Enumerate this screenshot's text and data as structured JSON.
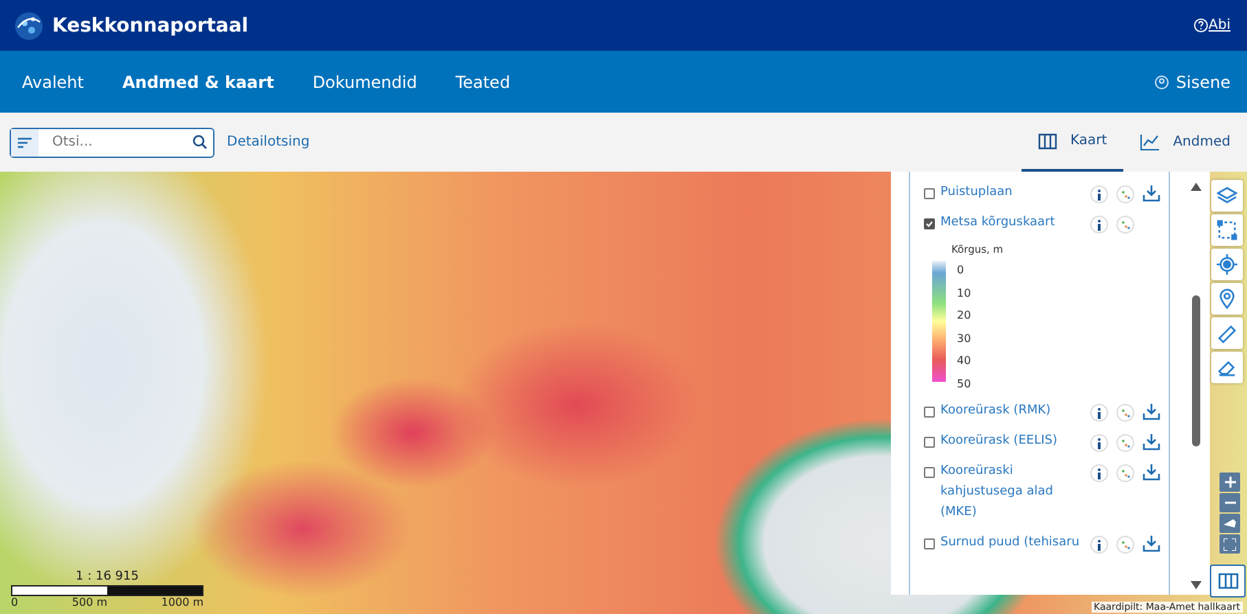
{
  "header": {
    "brand": "Keskkonnaportaal",
    "help": "Abi"
  },
  "nav": {
    "items": [
      {
        "label": "Avaleht",
        "selected": false
      },
      {
        "label": "Andmed & kaart",
        "selected": true
      },
      {
        "label": "Dokumendid",
        "selected": false
      },
      {
        "label": "Teated",
        "selected": false
      }
    ],
    "login": "Sisene"
  },
  "toolbar": {
    "search": {
      "placeholder": "Otsi..."
    },
    "advanced_search": "Detailotsing",
    "views": [
      {
        "label": "Kaart",
        "selected": true,
        "kind": "map"
      },
      {
        "label": "Andmed",
        "selected": false,
        "kind": "chart"
      }
    ]
  },
  "layers": [
    {
      "label": "Puistuplaan",
      "checked": false,
      "downloadable": true
    },
    {
      "label": "Metsa kõrguskaart",
      "checked": true,
      "downloadable": false,
      "legend": {
        "title": "Kõrgus, m",
        "labels": [
          "0",
          "10",
          "20",
          "30",
          "40",
          "50"
        ]
      }
    },
    {
      "label": "Kooreürask (RMK)",
      "checked": false,
      "downloadable": true
    },
    {
      "label": "Kooreürask (EELIS)",
      "checked": false,
      "downloadable": true
    },
    {
      "label": "Kooreüraski kahjustusega alad (MKE)",
      "checked": false,
      "downloadable": true
    },
    {
      "label": "Surnud puud (tehisaru",
      "checked": false,
      "downloadable": true
    }
  ],
  "scale": {
    "ratio": "1 : 16 915",
    "ticks": [
      "0",
      "500 m",
      "1000 m"
    ]
  },
  "attribution": "Kaardipilt: Maa-Amet hallkaart"
}
